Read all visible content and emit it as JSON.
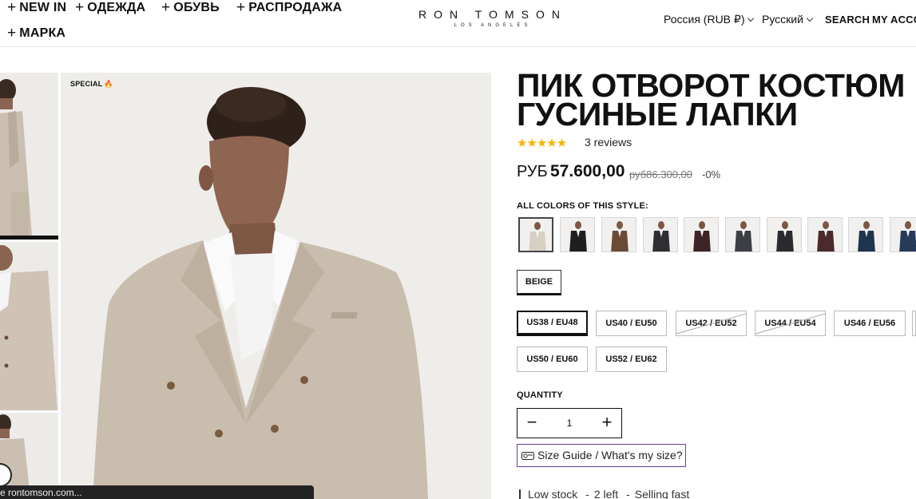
{
  "header": {
    "nav": [
      {
        "label": "NEW IN"
      },
      {
        "label": "ОДЕЖДА"
      },
      {
        "label": "ОБУВЬ"
      },
      {
        "label": "РАСПРОДАЖА"
      },
      {
        "label": "МАРКА"
      }
    ],
    "logo_main": "RON TOMSON",
    "logo_sub": "LOS ANGELES",
    "region": "Россия (RUB ₽)",
    "language": "Русский",
    "search": "SEARCH",
    "account": "MY ACCOUNT"
  },
  "gallery": {
    "badge": "SPECIAL",
    "badge_icon": "flame-icon"
  },
  "status_bar": "e rontomson.com...",
  "product": {
    "title_line1": "ПИК ОТВОРОТ КОСТЮМ",
    "title_line2": "ГУСИНЫЕ ЛАПКИ",
    "stars": "★★★★★",
    "rating": 5,
    "reviews": "3 reviews",
    "price_currency": "РУБ",
    "price": "57.600,00",
    "old_price": "руб86.300,00",
    "discount": "-0%",
    "colors_label": "ALL COLORS OF THIS STYLE:",
    "swatch_colors": [
      "#d8cfc3",
      "#1f1f22",
      "#6b4a36",
      "#2e2f33",
      "#3d2426",
      "#3b3e42",
      "#2a2b2e",
      "#4a2a2c",
      "#1d3550",
      "#263a5a"
    ],
    "selected_color": "BEIGE",
    "sizes": [
      {
        "label": "US38 / EU48",
        "state": "selected"
      },
      {
        "label": "US40 / EU50",
        "state": "available"
      },
      {
        "label": "US42 / EU52",
        "state": "soldout"
      },
      {
        "label": "US44 / EU54",
        "state": "soldout"
      },
      {
        "label": "US46 / EU56",
        "state": "available"
      },
      {
        "label": "US50 / EU60",
        "state": "available"
      },
      {
        "label": "US52 / EU62",
        "state": "available"
      }
    ],
    "quantity_label": "QUANTITY",
    "quantity": "1",
    "minus": "−",
    "plus": "+",
    "size_guide": "Size Guide / What's my size?",
    "stock_low": "Low stock",
    "stock_left": "2 left",
    "stock_fast": "Selling fast",
    "stock_sep": "-"
  }
}
